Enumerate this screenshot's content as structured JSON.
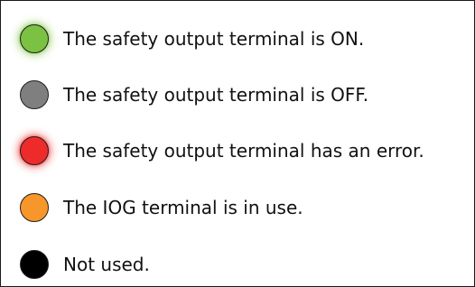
{
  "legend": {
    "items": [
      {
        "label": "The safety output terminal is ON.",
        "color": "#7cc242",
        "glow": "#7cc242",
        "icon": "green-status-lamp-icon"
      },
      {
        "label": "The safety output terminal is OFF.",
        "color": "#7f7f7f",
        "glow": "",
        "icon": "gray-status-lamp-icon"
      },
      {
        "label": "The safety output terminal has an error.",
        "color": "#ee2b2b",
        "glow": "#ee2b2b",
        "icon": "red-status-lamp-icon"
      },
      {
        "label": "The IOG terminal is in use.",
        "color": "#f7962b",
        "glow": "",
        "icon": "orange-status-lamp-icon"
      },
      {
        "label": "Not used.",
        "color": "#000000",
        "glow": "",
        "icon": "black-status-lamp-icon"
      }
    ]
  }
}
